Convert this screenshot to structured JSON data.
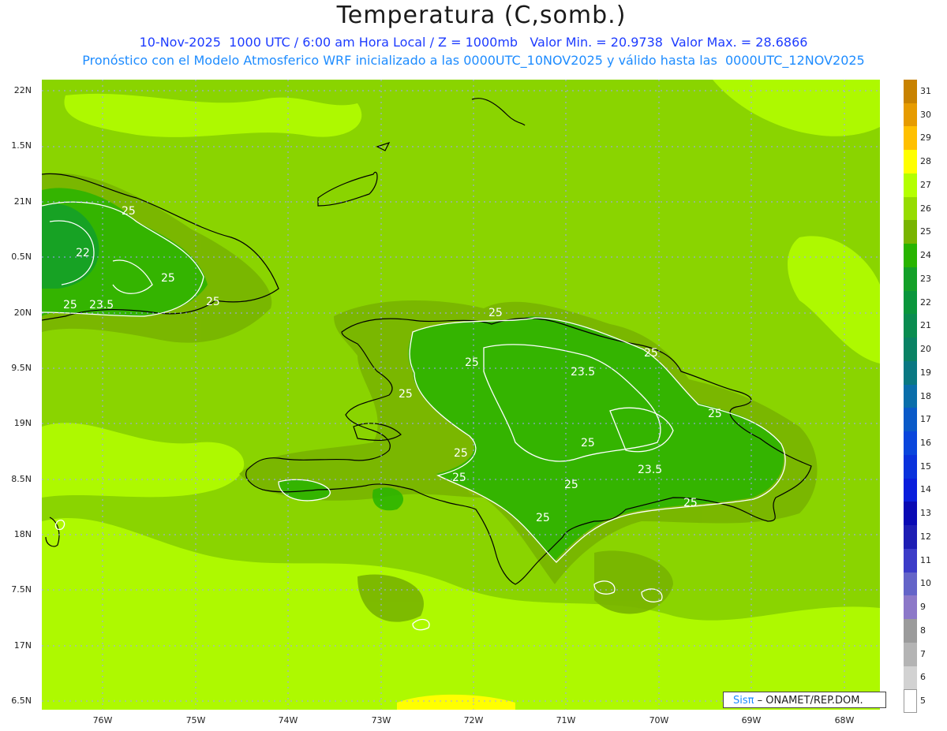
{
  "title": "Temperatura (C,somb.)",
  "subtitle_line1": "10-Nov-2025  1000 UTC / 6:00 am Hora Local / Z = 1000mb   Valor Min. = 20.9738  Valor Max. = 28.6866",
  "subtitle_line2": "Pronóstico con el Modelo Atmosferico WRF inicializado a las 0000UTC_10NOV2025 y válido hasta las  0000UTC_12NOV2025",
  "lat_labels": [
    "22N",
    "1.5N",
    "21N",
    "0.5N",
    "20N",
    "9.5N",
    "19N",
    "8.5N",
    "18N",
    "7.5N",
    "17N",
    "6.5N"
  ],
  "lon_labels": [
    "76W",
    "75W",
    "74W",
    "73W",
    "72W",
    "71W",
    "70W",
    "69W",
    "68W"
  ],
  "colorbar": {
    "labels": [
      "31",
      "30",
      "29",
      "28",
      "27",
      "26",
      "25",
      "24",
      "23",
      "22",
      "21",
      "20",
      "19",
      "18",
      "17",
      "16",
      "15",
      "14",
      "13",
      "12",
      "11",
      "10",
      "9",
      "8",
      "7",
      "6",
      "5"
    ],
    "colors": [
      "#c88200",
      "#e69b00",
      "#ffc000",
      "#ffff00",
      "#b4ff00",
      "#96dc00",
      "#78b400",
      "#28b400",
      "#14a028",
      "#0a963c",
      "#0a8c50",
      "#0a8264",
      "#0a7882",
      "#0a6eaa",
      "#0a5ac8",
      "#0a46dc",
      "#0a32dc",
      "#0a1edc",
      "#0a0ab4",
      "#1e1eb4",
      "#3c3cc8",
      "#6464c8",
      "#8c78c8",
      "#9b9b9b",
      "#b4b4b4",
      "#d2d2d2",
      "#ffffff"
    ]
  },
  "contour_labels": [
    "25",
    "22",
    "25",
    "25",
    "23.5",
    "25",
    "25",
    "25",
    "25",
    "23.5",
    "25",
    "25",
    "25",
    "25",
    "25",
    "23.5",
    "25",
    "25",
    "25"
  ],
  "credit": {
    "brand": "Sisπ",
    "text": "– ONAMET/REP.DOM."
  }
}
